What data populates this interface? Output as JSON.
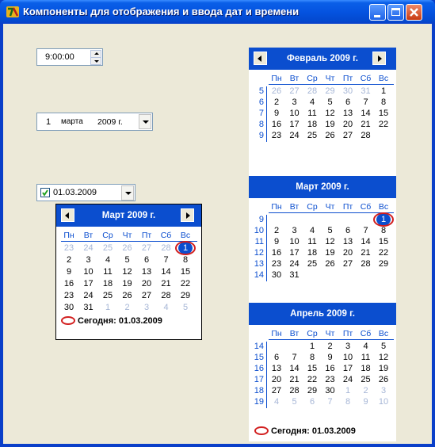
{
  "window": {
    "title": "Компоненты для отображения и ввода дат и времени"
  },
  "time_picker": {
    "value": "9:00:00"
  },
  "date_combo": {
    "day": "1",
    "month": "марта",
    "year": "2009 г."
  },
  "date_check": {
    "checked": true,
    "value": "01.03.2009"
  },
  "dow": [
    "Пн",
    "Вт",
    "Ср",
    "Чт",
    "Пт",
    "Сб",
    "Вс"
  ],
  "popup": {
    "header": "Март 2009 г.",
    "rows": [
      [
        "23",
        "24",
        "25",
        "26",
        "27",
        "28",
        "1"
      ],
      [
        "2",
        "3",
        "4",
        "5",
        "6",
        "7",
        "8"
      ],
      [
        "9",
        "10",
        "11",
        "12",
        "13",
        "14",
        "15"
      ],
      [
        "16",
        "17",
        "18",
        "19",
        "20",
        "21",
        "22"
      ],
      [
        "23",
        "24",
        "25",
        "26",
        "27",
        "28",
        "29"
      ],
      [
        "30",
        "31",
        "1",
        "2",
        "3",
        "4",
        "5"
      ]
    ],
    "dim": [
      [
        0,
        0
      ],
      [
        0,
        1
      ],
      [
        0,
        2
      ],
      [
        0,
        3
      ],
      [
        0,
        4
      ],
      [
        0,
        5
      ],
      [
        5,
        2
      ],
      [
        5,
        3
      ],
      [
        5,
        4
      ],
      [
        5,
        5
      ],
      [
        5,
        6
      ]
    ],
    "selected": [
      0,
      6
    ],
    "today": "Сегодня: 01.03.2009"
  },
  "month_cal": {
    "months": [
      {
        "header": "Февраль 2009 г.",
        "weeks": [
          "5",
          "6",
          "7",
          "8",
          "9"
        ],
        "rows": [
          [
            "26",
            "27",
            "28",
            "29",
            "30",
            "31",
            "1"
          ],
          [
            "2",
            "3",
            "4",
            "5",
            "6",
            "7",
            "8"
          ],
          [
            "9",
            "10",
            "11",
            "12",
            "13",
            "14",
            "15"
          ],
          [
            "16",
            "17",
            "18",
            "19",
            "20",
            "21",
            "22"
          ],
          [
            "23",
            "24",
            "25",
            "26",
            "27",
            "28",
            ""
          ]
        ],
        "dim": [
          [
            0,
            0
          ],
          [
            0,
            1
          ],
          [
            0,
            2
          ],
          [
            0,
            3
          ],
          [
            0,
            4
          ],
          [
            0,
            5
          ]
        ]
      },
      {
        "header": "Март 2009 г.",
        "weeks": [
          "9",
          "10",
          "11",
          "12",
          "13",
          "14"
        ],
        "rows": [
          [
            "",
            "",
            "",
            "",
            "",
            "",
            "1"
          ],
          [
            "2",
            "3",
            "4",
            "5",
            "6",
            "7",
            "8"
          ],
          [
            "9",
            "10",
            "11",
            "12",
            "13",
            "14",
            "15"
          ],
          [
            "16",
            "17",
            "18",
            "19",
            "20",
            "21",
            "22"
          ],
          [
            "23",
            "24",
            "25",
            "26",
            "27",
            "28",
            "29"
          ],
          [
            "30",
            "31",
            "",
            "",
            "",
            "",
            ""
          ]
        ],
        "dim": [],
        "selected": [
          0,
          6
        ]
      },
      {
        "header": "Апрель 2009 г.",
        "weeks": [
          "14",
          "15",
          "16",
          "17",
          "18",
          "19"
        ],
        "rows": [
          [
            "",
            "",
            "1",
            "2",
            "3",
            "4",
            "5"
          ],
          [
            "6",
            "7",
            "8",
            "9",
            "10",
            "11",
            "12"
          ],
          [
            "13",
            "14",
            "15",
            "16",
            "17",
            "18",
            "19"
          ],
          [
            "20",
            "21",
            "22",
            "23",
            "24",
            "25",
            "26"
          ],
          [
            "27",
            "28",
            "29",
            "30",
            "1",
            "2",
            "3"
          ],
          [
            "4",
            "5",
            "6",
            "7",
            "8",
            "9",
            "10"
          ]
        ],
        "dim": [
          [
            4,
            4
          ],
          [
            4,
            5
          ],
          [
            4,
            6
          ],
          [
            5,
            0
          ],
          [
            5,
            1
          ],
          [
            5,
            2
          ],
          [
            5,
            3
          ],
          [
            5,
            4
          ],
          [
            5,
            5
          ],
          [
            5,
            6
          ]
        ]
      }
    ],
    "today": "Сегодня: 01.03.2009"
  },
  "colors": {
    "accent": "#0b4ecf",
    "today_ring": "#d21f1f",
    "dim_day": "#a6b6d6"
  }
}
